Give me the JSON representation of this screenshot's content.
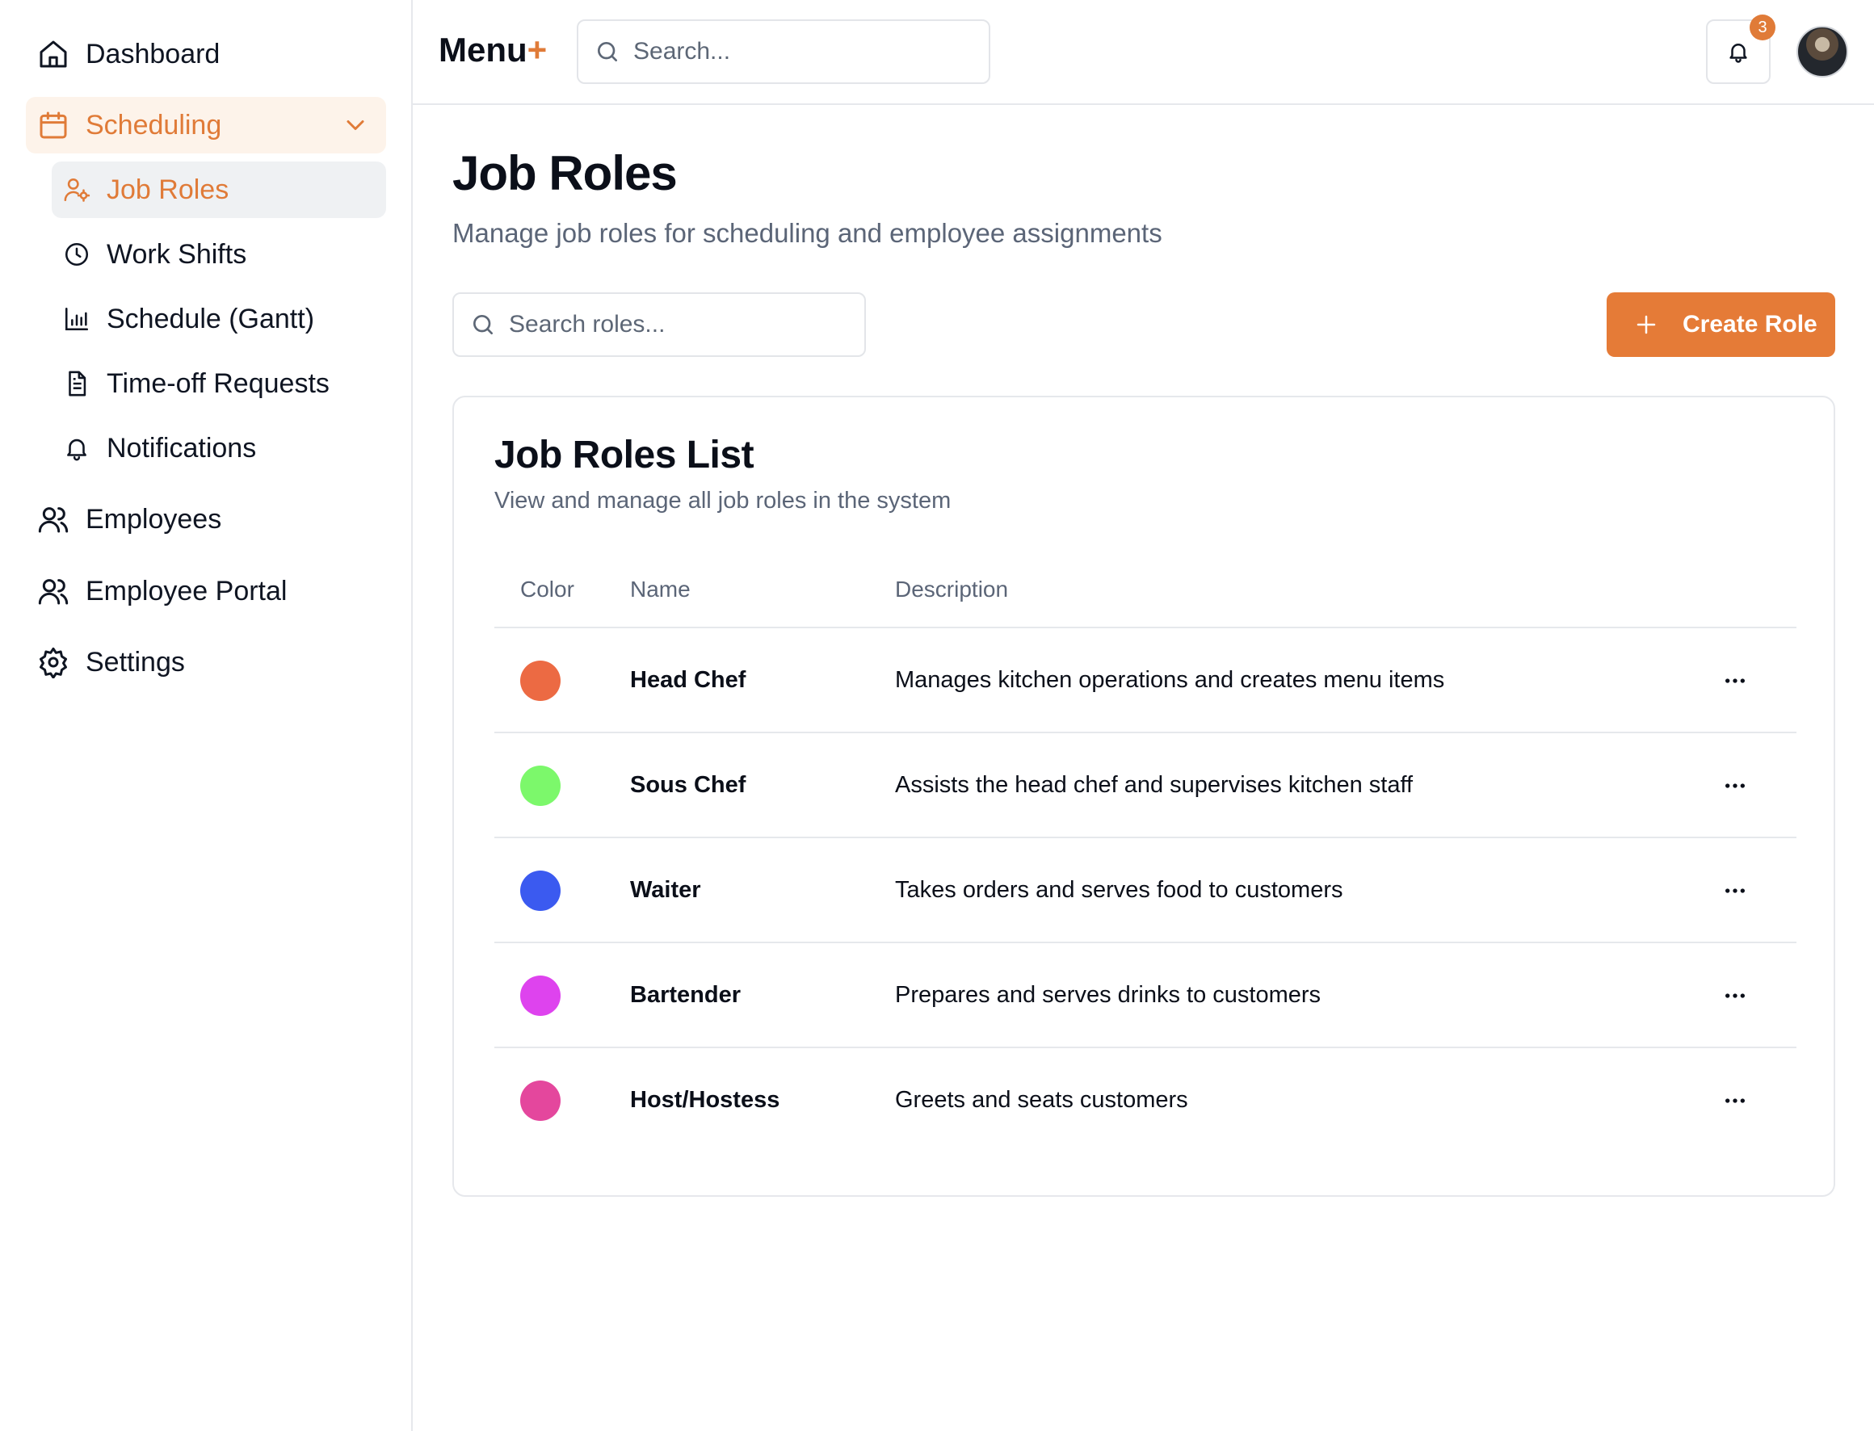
{
  "sidebar": {
    "items": [
      {
        "label": "Dashboard",
        "icon": "home-icon"
      },
      {
        "label": "Scheduling",
        "icon": "calendar-icon"
      },
      {
        "label": "Employees",
        "icon": "users-icon"
      },
      {
        "label": "Employee Portal",
        "icon": "users-icon"
      },
      {
        "label": "Settings",
        "icon": "gear-icon"
      }
    ],
    "scheduling_sub": [
      {
        "label": "Job Roles",
        "icon": "user-cog-icon"
      },
      {
        "label": "Work Shifts",
        "icon": "clock-icon"
      },
      {
        "label": "Schedule (Gantt)",
        "icon": "bar-chart-icon"
      },
      {
        "label": "Time-off Requests",
        "icon": "document-icon"
      },
      {
        "label": "Notifications",
        "icon": "bell-icon"
      }
    ]
  },
  "header": {
    "brand": "Menu",
    "brand_plus": "+",
    "search_placeholder": "Search...",
    "notification_count": "3"
  },
  "main": {
    "title": "Job Roles",
    "subtitle": "Manage job roles for scheduling and employee assignments",
    "search_placeholder": "Search roles...",
    "create_label": "Create Role",
    "card_title": "Job Roles List",
    "card_subtitle": "View and manage all job roles in the system",
    "columns": [
      "Color",
      "Name",
      "Description"
    ],
    "rows": [
      {
        "color": "#ec6a43",
        "name": "Head Chef",
        "description": "Manages kitchen operations and creates menu items"
      },
      {
        "color": "#7cf86b",
        "name": "Sous Chef",
        "description": "Assists the head chef and supervises kitchen staff"
      },
      {
        "color": "#3b5af0",
        "name": "Waiter",
        "description": "Takes orders and serves food to customers"
      },
      {
        "color": "#de43ee",
        "name": "Bartender",
        "description": "Prepares and serves drinks to customers"
      },
      {
        "color": "#e4479d",
        "name": "Host/Hostess",
        "description": "Greets and seats customers"
      }
    ]
  },
  "colors": {
    "accent": "#e07b38"
  }
}
